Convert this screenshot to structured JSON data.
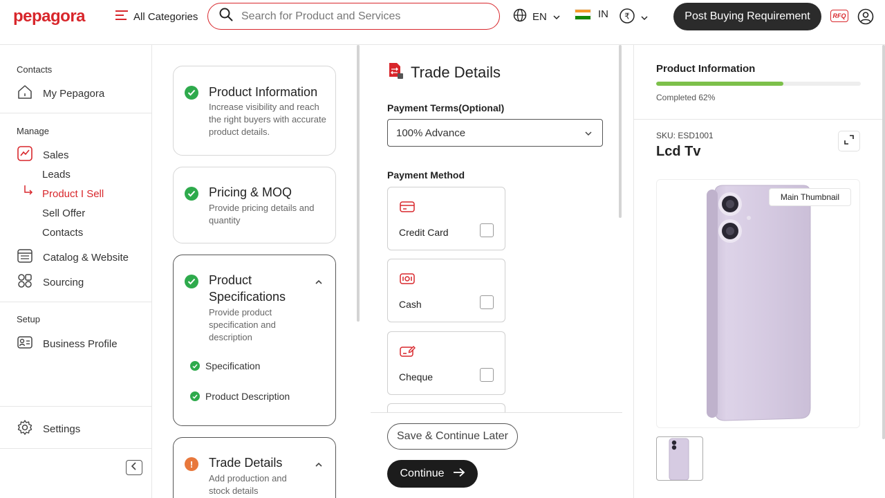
{
  "header": {
    "logo": "pepagora",
    "all_categories": "All Categories",
    "search_placeholder": "Search for Product and Services",
    "language": "EN",
    "country": "IN",
    "post_button": "Post Buying Requirement",
    "rfq": "RFQ"
  },
  "sidebar": {
    "contacts_label": "Contacts",
    "my_pepagora": "My Pepagora",
    "manage_label": "Manage",
    "sales": "Sales",
    "leads": "Leads",
    "product_i_sell": "Product I Sell",
    "sell_offer": "Sell Offer",
    "contacts": "Contacts",
    "catalog": "Catalog & Website",
    "sourcing": "Sourcing",
    "setup_label": "Setup",
    "business_profile": "Business Profile",
    "settings": "Settings"
  },
  "steps": [
    {
      "title": "Product Information",
      "desc": "Increase visibility and reach the right buyers with accurate product details.",
      "status": "complete"
    },
    {
      "title": "Pricing & MOQ",
      "desc": "Provide pricing details and quantity",
      "status": "complete"
    },
    {
      "title": "Product Specifications",
      "desc": "Provide product specification and description",
      "status": "complete",
      "sub": [
        "Specification",
        "Product Description"
      ]
    },
    {
      "title": "Trade Details",
      "desc": "Add production and stock details",
      "status": "warning"
    }
  ],
  "trade": {
    "title": "Trade Details",
    "payment_terms_label": "Payment Terms(Optional)",
    "payment_terms_value": "100% Advance",
    "payment_method_label": "Payment Method",
    "methods": [
      "Credit Card",
      "Cash",
      "Cheque"
    ],
    "save_later": "Save & Continue Later",
    "continue": "Continue"
  },
  "product_panel": {
    "title": "Product Information",
    "progress": 0.62,
    "completed_text": "Completed 62%",
    "sku": "SKU: ESD1001",
    "name": "Lcd Tv",
    "thumb_badge": "Main Thumbnail"
  },
  "colors": {
    "brand": "#d8262b",
    "success": "#2eaa4c",
    "warning": "#e8783c",
    "progress": "#7cc04a"
  }
}
